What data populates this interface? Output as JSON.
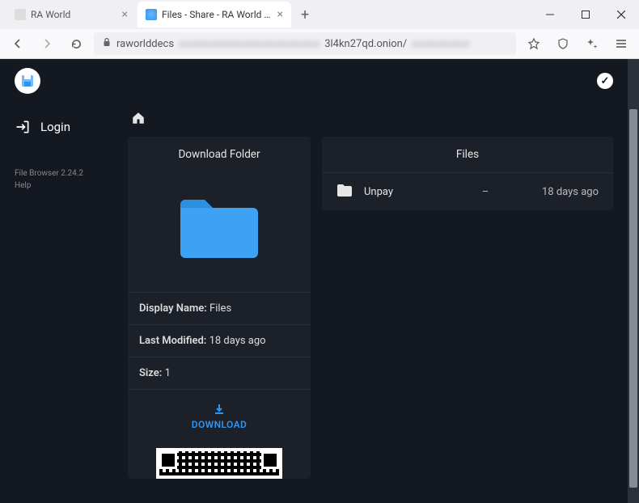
{
  "browser": {
    "tabs": [
      {
        "title": "RA World",
        "active": false
      },
      {
        "title": "Files - Share - RA World Leak",
        "active": true
      }
    ],
    "url_prefix": "raworlddecs",
    "url_middle": "xxxxxxxxxxxxxxxxxxxxxxxxxxx",
    "url_suffix": "3l4kn27qd.onion/",
    "url_tail": "xxxxxxxxxxx"
  },
  "sidebar": {
    "login_label": "Login",
    "meta_line1": "File Browser 2.24.2",
    "meta_line2": "Help"
  },
  "header": {
    "logo_icon": "floppy-disk-icon"
  },
  "download_card": {
    "title": "Download Folder",
    "display_name_label": "Display Name:",
    "display_name_value": "Files",
    "last_modified_label": "Last Modified:",
    "last_modified_value": "18 days ago",
    "size_label": "Size:",
    "size_value": "1",
    "button_label": "DOWNLOAD"
  },
  "files_card": {
    "title": "Files",
    "rows": [
      {
        "name": "Unpay",
        "size": "–",
        "date": "18 days ago"
      }
    ]
  }
}
